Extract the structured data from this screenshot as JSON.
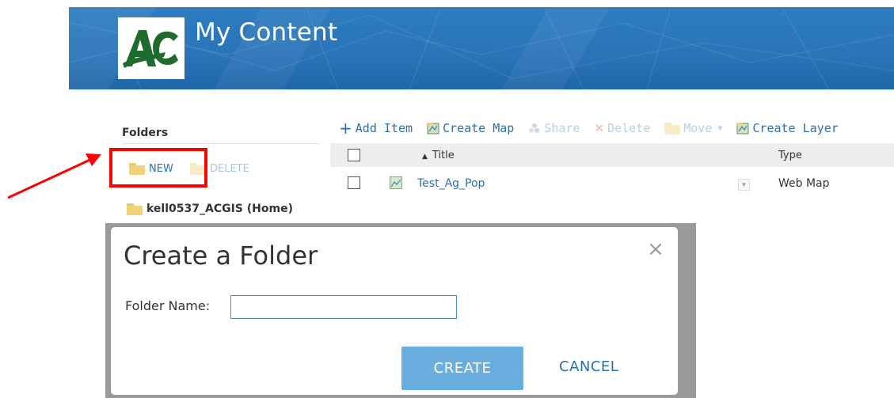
{
  "header": {
    "logo_text": "AC",
    "title": "My Content"
  },
  "sidebar": {
    "folders_heading": "Folders",
    "new_label": "NEW",
    "delete_label": "DELETE",
    "home_folder": "kell0537_ACGIS (Home)"
  },
  "toolbar": {
    "add_item": "Add Item",
    "create_map": "Create Map",
    "share": "Share",
    "delete": "Delete",
    "move": "Move",
    "create_layer": "Create Layer"
  },
  "table": {
    "columns": {
      "title": "Title",
      "type": "Type"
    },
    "sort_indicator": "▲",
    "rows": [
      {
        "title": "Test_Ag_Pop",
        "type": "Web Map"
      }
    ]
  },
  "dialog": {
    "title": "Create a Folder",
    "close_glyph": "×",
    "field_label": "Folder Name:",
    "field_value": "",
    "create_label": "CREATE",
    "cancel_label": "CANCEL"
  },
  "colors": {
    "banner": "#2a74b8",
    "link": "#2a6fb1",
    "logo_green": "#1e6b2e",
    "highlight": "#ff0000",
    "primary_button": "#6aaee0"
  }
}
